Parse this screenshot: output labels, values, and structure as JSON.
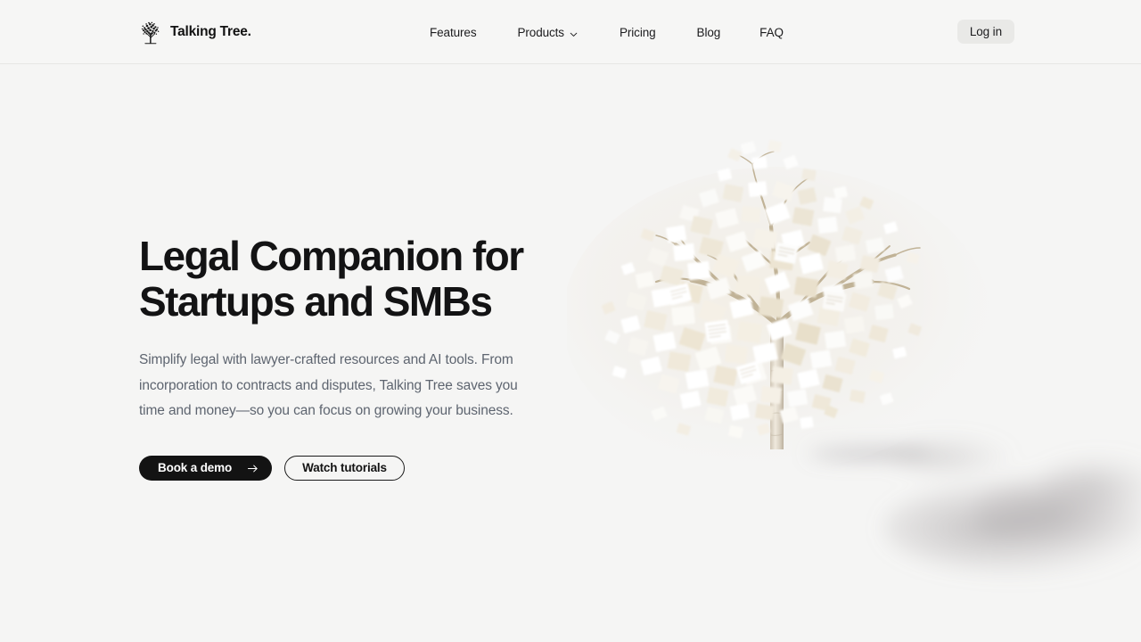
{
  "brand": {
    "name": "Talking Tree.",
    "logo_icon": "tree-icon"
  },
  "nav": {
    "items": [
      {
        "label": "Features",
        "has_dropdown": false
      },
      {
        "label": "Products",
        "has_dropdown": true,
        "dropdown_icon": "chevron-down-icon"
      },
      {
        "label": "Pricing",
        "has_dropdown": false
      },
      {
        "label": "Blog",
        "has_dropdown": false
      },
      {
        "label": "FAQ",
        "has_dropdown": false
      }
    ],
    "login_label": "Log in"
  },
  "hero": {
    "headline": "Legal Companion for\nStartups and SMBs",
    "subheadline": "Simplify legal with lawyer‑crafted resources and AI tools. From incorporation to contracts and disputes, Talking Tree saves you time and money—so you can focus on growing your business.",
    "primary_cta": {
      "label": "Book a demo",
      "icon": "arrow-right-icon"
    },
    "secondary_cta": {
      "label": "Watch tutorials"
    },
    "illustration": {
      "name": "paper-leaf-tree-illustration",
      "description": "Tree with paper document leaves and soft cast shadow"
    }
  },
  "colors": {
    "page_background": "#f5f5f4",
    "header_background": "#f6f6f5",
    "header_border": "#e6e6e4",
    "text_primary": "#131314",
    "text_muted": "#5e6570",
    "primary_button_bg": "#131313",
    "primary_button_text": "#ffffff",
    "login_button_bg": "#e9e9e7",
    "leaf_cream": "#efe9dd",
    "leaf_white": "#fbfbfa",
    "branch_brown": "#b9a98f"
  }
}
